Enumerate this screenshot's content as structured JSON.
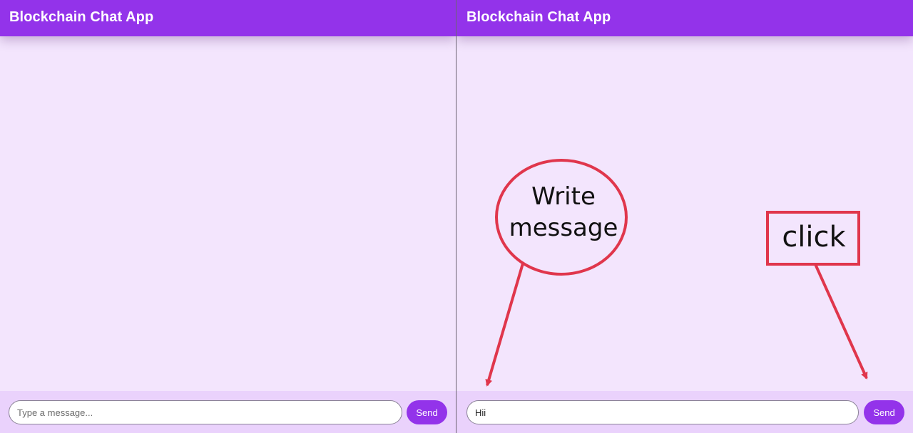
{
  "left_pane": {
    "header": {
      "title": "Blockchain Chat App"
    },
    "composer": {
      "input_value": "",
      "input_placeholder": "Type a message...",
      "send_label": "Send"
    }
  },
  "right_pane": {
    "header": {
      "title": "Blockchain Chat App"
    },
    "composer": {
      "input_value": "Hii",
      "input_placeholder": "Type a message...",
      "send_label": "Send"
    }
  },
  "annotations": {
    "write_label": "Write message",
    "click_label": "click",
    "color": "#e0364c"
  },
  "theme": {
    "header_color": "#9333ea",
    "chat_background": "#f3e5fd",
    "composer_background": "#ead2fc"
  }
}
